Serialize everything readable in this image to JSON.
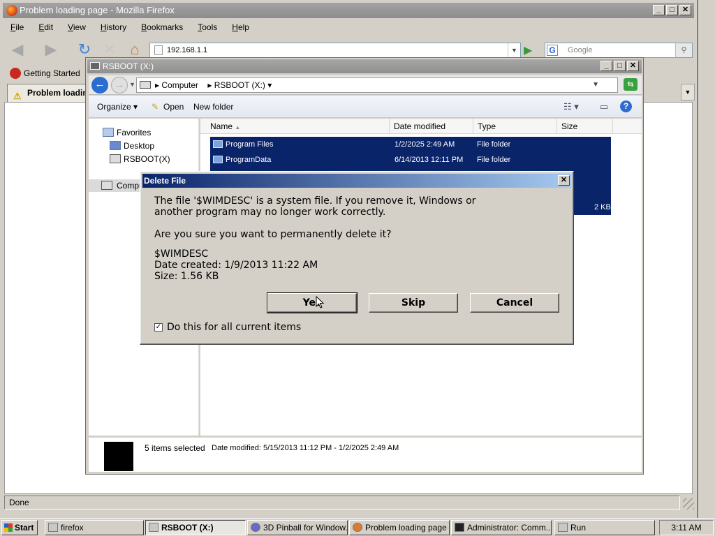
{
  "firefox": {
    "title": "Problem loading page - Mozilla Firefox",
    "menu": [
      "File",
      "Edit",
      "View",
      "History",
      "Bookmarks",
      "Tools",
      "Help"
    ],
    "url": "192.168.1.1",
    "search_placeholder": "Google",
    "bookmark": "Getting Started",
    "tab": "Problem loading page",
    "status": "Done"
  },
  "explorer": {
    "title": "RSBOOT (X:)",
    "breadcrumb": [
      "Computer",
      "RSBOOT (X:)"
    ],
    "commands": {
      "organize": "Organize",
      "open": "Open",
      "new_folder": "New folder"
    },
    "nav": {
      "favorites": "Favorites",
      "desktop": "Desktop",
      "rsboot": "RSBOOT(X)",
      "computer": "Computer"
    },
    "columns": {
      "name": "Name",
      "date": "Date modified",
      "type": "Type",
      "size": "Size"
    },
    "rows": [
      {
        "name": "Program Files",
        "date": "1/2/2025 2:49 AM",
        "type": "File folder",
        "size": ""
      },
      {
        "name": "ProgramData",
        "date": "6/14/2013 12:11 PM",
        "type": "File folder",
        "size": ""
      }
    ],
    "hidden_row_size": "2 KB",
    "details": {
      "count": "5 items selected",
      "date_range": "Date modified: 5/15/2013 11:12 PM - 1/2/2025 2:49 AM"
    }
  },
  "dialog": {
    "title": "Delete File",
    "message_line1": "The file '$WIMDESC' is a system file. If you remove it, Windows or",
    "message_line2": "another program may no longer work correctly.",
    "question": "Are you sure you want to permanently delete it?",
    "file_name": "$WIMDESC",
    "date_created": "Date created: 1/9/2013 11:22 AM",
    "size": "Size: 1.56 KB",
    "buttons": {
      "yes": "Yes",
      "skip": "Skip",
      "cancel": "Cancel"
    },
    "checkbox_label": "Do this for all current items",
    "checkbox_checked": true
  },
  "taskbar": {
    "start": "Start",
    "tasks": [
      "firefox",
      "RSBOOT (X:)",
      "3D Pinball for Window...",
      "Problem loading page ...",
      "Administrator: Comm...",
      "Run"
    ],
    "clock": "3:11 AM"
  }
}
